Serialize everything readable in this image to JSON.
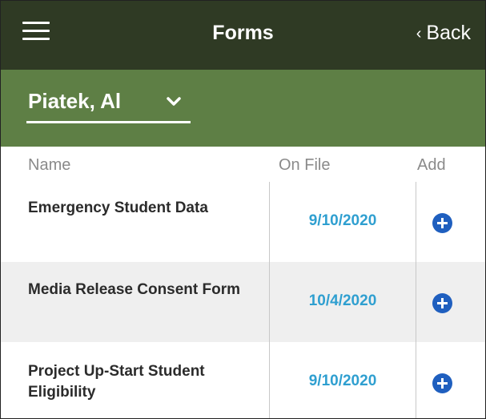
{
  "header": {
    "title": "Forms",
    "back_label": "Back"
  },
  "student": {
    "name": "Piatek, Al"
  },
  "columns": {
    "name": "Name",
    "on_file": "On File",
    "add": "Add"
  },
  "rows": [
    {
      "name": "Emergency Student Data",
      "date": "9/10/2020"
    },
    {
      "name": "Media Release Consent Form",
      "date": "10/4/2020"
    },
    {
      "name": "Project Up-Start Student Eligibility",
      "date": "9/10/2020"
    }
  ],
  "colors": {
    "header_bg": "#2f3a24",
    "student_bar_bg": "#5e7f45",
    "date_text": "#2f9fd0",
    "add_button": "#1f5fbf"
  }
}
